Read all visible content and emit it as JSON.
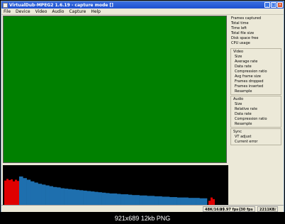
{
  "window": {
    "title": "VirtualDub-MPEG2 1.6.19 - capture mode []"
  },
  "menu": [
    "File",
    "Device",
    "Video",
    "Audio",
    "Capture",
    "Help"
  ],
  "stats": {
    "general": [
      "Frames captured",
      "Total time",
      "Time left",
      "Total file size",
      "Disk space free",
      "CPU usage"
    ],
    "video": {
      "title": "Video",
      "items": [
        "Size",
        "Average rate",
        "Data rate",
        "Compression ratio",
        "Avg frame size",
        "Frames dropped",
        "Frames inserted",
        "Resample"
      ]
    },
    "audio": {
      "title": "Audio",
      "items": [
        "Size",
        "Relative rate",
        "Data rate",
        "Compression ratio",
        "Resample"
      ]
    },
    "sync": {
      "title": "Sync",
      "items": [
        "VT adjust",
        "Current error"
      ]
    }
  },
  "status": {
    "audio_format": "48K/16/s",
    "framerate": "29.97 fps",
    "framerate_note": "(30 fps",
    "size": "2211KB/"
  },
  "footer": {
    "caption": "921x689 12kb PNG"
  },
  "colors": {
    "video_preview": "#008000",
    "histogram_blue": "#1e6fae",
    "histogram_red": "#e00000"
  },
  "histogram": {
    "red_left": [
      0.62,
      0.66,
      0.63,
      0.65,
      0.6,
      0.64,
      0.61
    ],
    "blue": [
      0.72,
      0.68,
      0.64,
      0.6,
      0.57,
      0.54,
      0.52,
      0.5,
      0.48,
      0.46,
      0.45,
      0.43,
      0.42,
      0.41,
      0.4,
      0.39,
      0.38,
      0.37,
      0.36,
      0.35,
      0.34,
      0.33,
      0.32,
      0.31,
      0.3,
      0.3,
      0.29,
      0.28,
      0.28,
      0.27,
      0.26,
      0.26,
      0.25,
      0.25,
      0.24,
      0.24,
      0.23,
      0.23,
      0.22,
      0.22,
      0.21,
      0.21,
      0.2,
      0.2,
      0.2,
      0.19,
      0.19,
      0.19,
      0.18,
      0.18
    ],
    "red_right": [
      0.12,
      0.2,
      0.16
    ]
  }
}
